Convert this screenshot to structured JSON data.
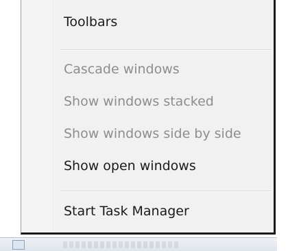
{
  "menu": {
    "items": [
      {
        "label": "Toolbars",
        "enabled": true
      },
      {
        "label": "Cascade windows",
        "enabled": false
      },
      {
        "label": "Show windows stacked",
        "enabled": false
      },
      {
        "label": "Show windows side by side",
        "enabled": false
      },
      {
        "label": "Show open windows",
        "enabled": true
      },
      {
        "label": "Start Task Manager",
        "enabled": true
      }
    ]
  }
}
